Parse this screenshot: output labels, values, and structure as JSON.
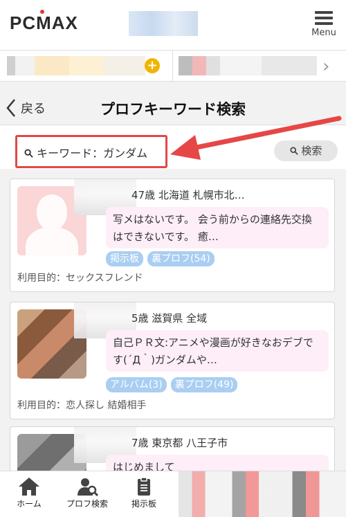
{
  "header": {
    "logo": "PCMAX",
    "menu_label": "Menu"
  },
  "nav": {
    "back_label": "戻る",
    "title": "プロフキーワード検索"
  },
  "search": {
    "input_text": "キーワード：ガンダム",
    "button_label": "検索"
  },
  "results": [
    {
      "age_location": "47歳 北海道 札幌市北…",
      "age_display": "47歳 北海道 札幌市北…",
      "message": "写メはないです。 会う前からの連絡先交換はできないです。 癒…",
      "tags": [
        "掲示板",
        "裏プロフ(54)"
      ],
      "purpose": "利用目的：セックスフレンド"
    },
    {
      "age_location": "5歳 滋賀県 全域",
      "message": "自己ＰＲ文:アニメや漫画が好きなおデブです(´Д｀)ガンダムや…",
      "tags": [
        "アルバム(3)",
        "裏プロフ(49)"
      ],
      "purpose": "利用目的：恋人探し 結婚相手"
    },
    {
      "age_location": "7歳 東京都 八王子市",
      "message": "はじめまして",
      "tags": [],
      "purpose": ""
    }
  ],
  "bottom_nav": {
    "home": "ホーム",
    "profile_search": "プロフ検索",
    "board": "掲示板"
  },
  "colors": {
    "highlight": "#e04848",
    "tag": "#a9cef2",
    "bubble": "#fdeef7"
  },
  "icons": [
    "plus-icon",
    "chevron-right-icon",
    "chevron-left-icon",
    "search-icon",
    "home-icon",
    "profile-search-icon",
    "clipboard-icon",
    "menu-icon"
  ]
}
